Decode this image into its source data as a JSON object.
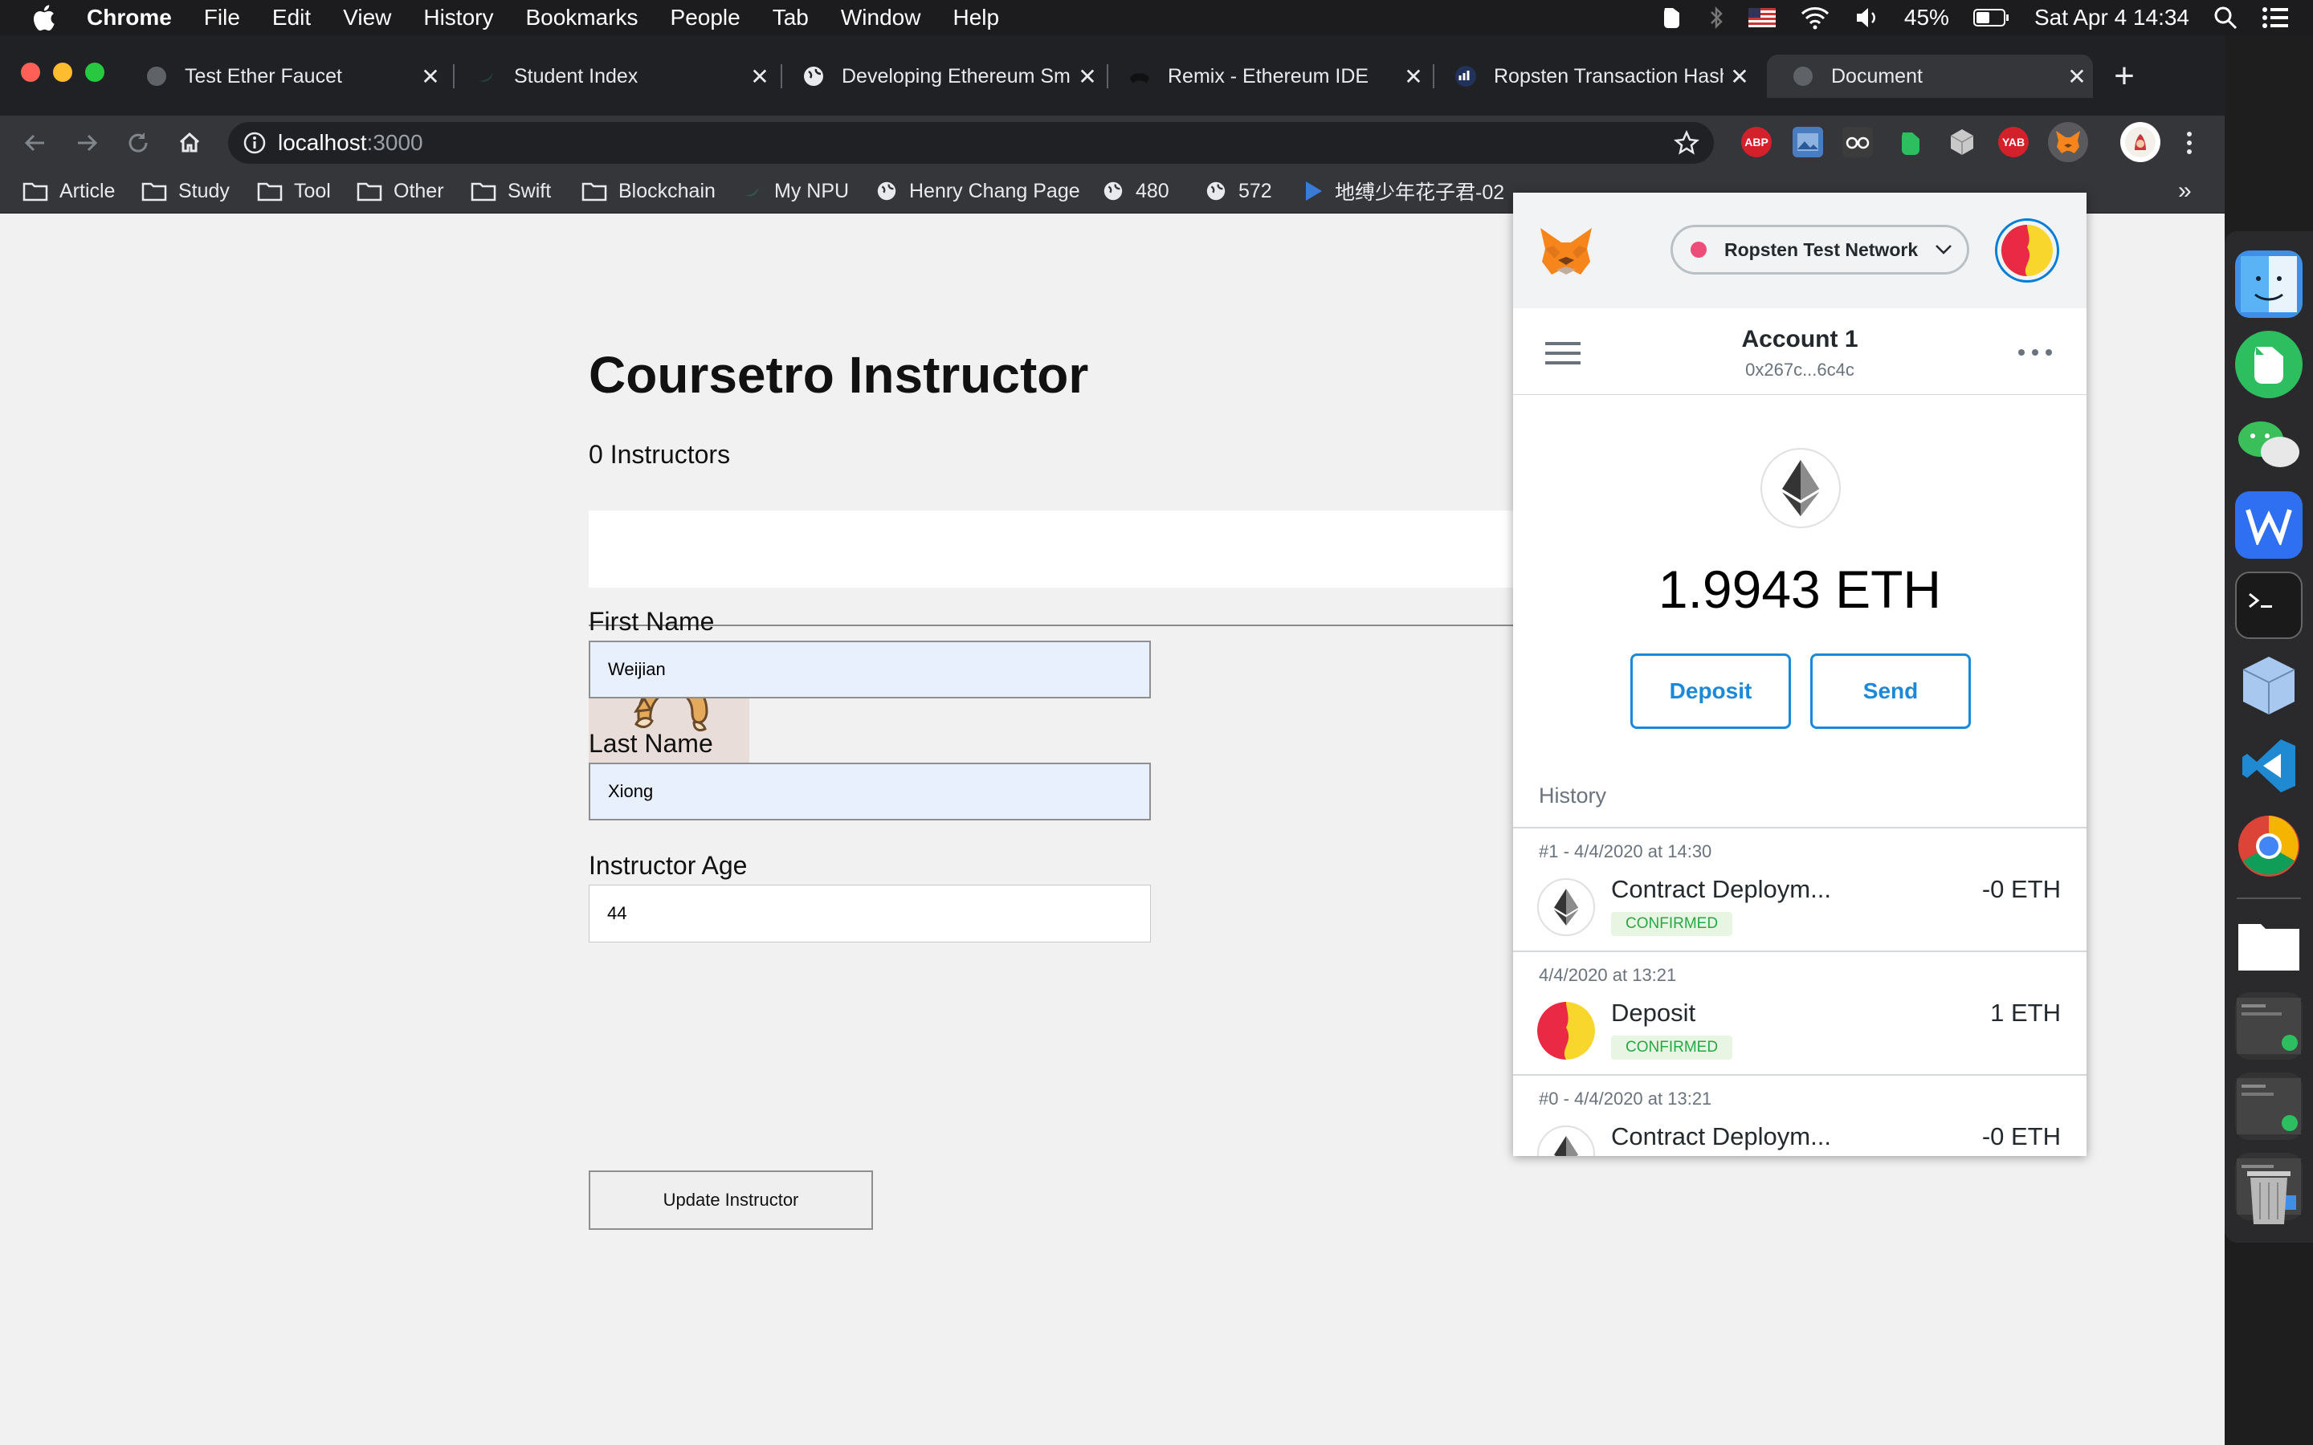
{
  "menubar": {
    "app_name": "Chrome",
    "menus": [
      "File",
      "Edit",
      "View",
      "History",
      "Bookmarks",
      "People",
      "Tab",
      "Window",
      "Help"
    ],
    "battery": "45%",
    "clock": "Sat Apr 4  14:34"
  },
  "tabs": [
    {
      "title": "Test Ether Faucet"
    },
    {
      "title": "Student Index"
    },
    {
      "title": "Developing Ethereum Sma"
    },
    {
      "title": "Remix - Ethereum IDE"
    },
    {
      "title": "Ropsten Transaction Hash"
    },
    {
      "title": "Document"
    }
  ],
  "address": {
    "host": "localhost",
    "port": ":3000"
  },
  "extensions": {
    "abp": "ABP",
    "yab": "YAB"
  },
  "bookmarks": [
    {
      "label": "Article"
    },
    {
      "label": "Study"
    },
    {
      "label": "Tool"
    },
    {
      "label": "Other"
    },
    {
      "label": "Swift"
    },
    {
      "label": "Blockchain"
    },
    {
      "label": "My NPU"
    },
    {
      "label": "Henry Chang Page"
    },
    {
      "label": "480"
    },
    {
      "label": "572"
    },
    {
      "label": "地缚少年花子君-02"
    }
  ],
  "bookmarks_more": "»",
  "page": {
    "title": "Coursetro Instructor",
    "count": "0 Instructors",
    "first_name_label": "First Name",
    "first_name_value": "Weijian",
    "last_name_label": "Last Name",
    "last_name_value": "Xiong",
    "age_label": "Instructor Age",
    "age_value": "44",
    "update_button": "Update Instructor"
  },
  "metamask": {
    "network": "Ropsten Test Network",
    "account_name": "Account 1",
    "account_address": "0x267c...6c4c",
    "balance": "1.9943 ETH",
    "deposit_button": "Deposit",
    "send_button": "Send",
    "history_label": "History",
    "transactions": [
      {
        "date": "#1 - 4/4/2020 at 14:30",
        "title": "Contract Deploym...",
        "status": "CONFIRMED",
        "amount": "-0 ETH"
      },
      {
        "date": "4/4/2020 at 13:21",
        "title": "Deposit",
        "status": "CONFIRMED",
        "amount": "1 ETH"
      },
      {
        "date": "#0 - 4/4/2020 at 13:21",
        "title": "Contract Deploym...",
        "status": "",
        "amount": "-0 ETH"
      }
    ]
  },
  "colors": {
    "metamask_blue": "#037dd6",
    "confirmed_green": "#28a745",
    "network_dot": "#e91550",
    "autofill_bg": "#e8f0fe"
  }
}
